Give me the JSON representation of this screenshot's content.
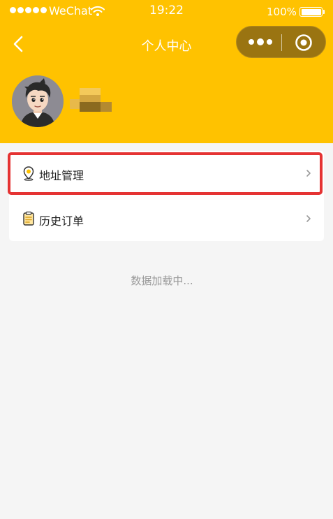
{
  "status_bar": {
    "carrier": "WeChat",
    "time": "19:22",
    "battery": "100%"
  },
  "nav": {
    "title": "个人中心",
    "back_icon": "chevron-left-icon",
    "more_icon": "more-dots-icon",
    "close_icon": "target-circle-icon"
  },
  "profile": {
    "avatar_icon": "cartoon-avatar",
    "username_state": "pixelated"
  },
  "menu": {
    "items": [
      {
        "label": "地址管理",
        "icon": "location-pin-icon"
      },
      {
        "label": "历史订单",
        "icon": "clipboard-icon"
      }
    ]
  },
  "loading_text": "数据加载中...",
  "colors": {
    "header_bg": "#ffc200",
    "capsule_bg": "#9a7411",
    "highlight": "#e53333",
    "page_bg": "#f5f5f5"
  }
}
